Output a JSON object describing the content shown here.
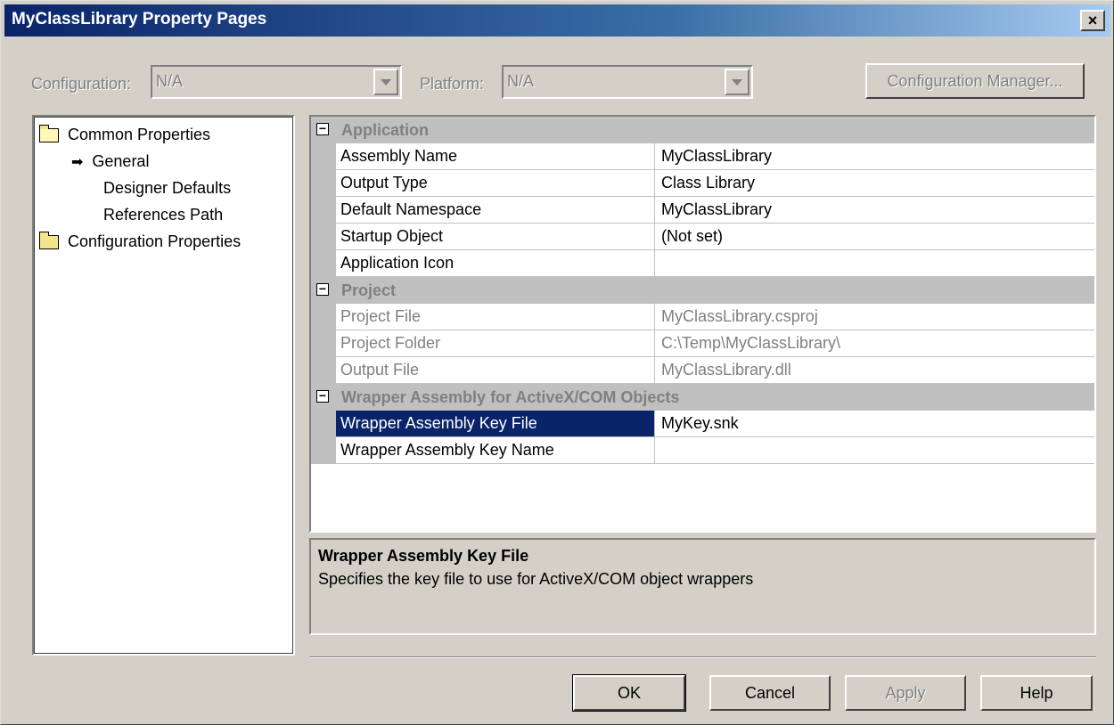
{
  "window": {
    "title": "MyClassLibrary Property Pages",
    "close_label": "×"
  },
  "toolbar": {
    "configuration_label": "Configuration:",
    "configuration_value": "N/A",
    "platform_label": "Platform:",
    "platform_value": "N/A",
    "config_manager_label": "Configuration Manager..."
  },
  "tree": {
    "items": [
      {
        "label": "Common Properties",
        "icon": "open-folder-icon"
      },
      {
        "label": "General",
        "icon": "arrow-icon"
      },
      {
        "label": "Designer Defaults"
      },
      {
        "label": "References Path"
      },
      {
        "label": "Configuration Properties",
        "icon": "folder-icon"
      }
    ]
  },
  "grid": {
    "categories": [
      {
        "name": "Application",
        "rows": [
          {
            "name": "Assembly Name",
            "value": "MyClassLibrary"
          },
          {
            "name": "Output Type",
            "value": "Class Library"
          },
          {
            "name": "Default Namespace",
            "value": "MyClassLibrary"
          },
          {
            "name": "Startup Object",
            "value": "(Not set)"
          },
          {
            "name": "Application Icon",
            "value": ""
          }
        ]
      },
      {
        "name": "Project",
        "rows": [
          {
            "name": "Project File",
            "value": "MyClassLibrary.csproj"
          },
          {
            "name": "Project Folder",
            "value": "C:\\Temp\\MyClassLibrary\\"
          },
          {
            "name": "Output File",
            "value": "MyClassLibrary.dll"
          }
        ]
      },
      {
        "name": "Wrapper Assembly for ActiveX/COM Objects",
        "rows": [
          {
            "name": "Wrapper Assembly Key File",
            "value": "MyKey.snk"
          },
          {
            "name": "Wrapper Assembly Key Name",
            "value": ""
          }
        ]
      }
    ]
  },
  "description": {
    "title": "Wrapper Assembly Key File",
    "text": "Specifies the key file to use for ActiveX/COM object wrappers"
  },
  "buttons": {
    "ok": "OK",
    "cancel": "Cancel",
    "apply": "Apply",
    "help": "Help"
  },
  "colors": {
    "title_bar": "#0a246a",
    "selection": "#0a246a",
    "face": "#d4d0c8"
  }
}
